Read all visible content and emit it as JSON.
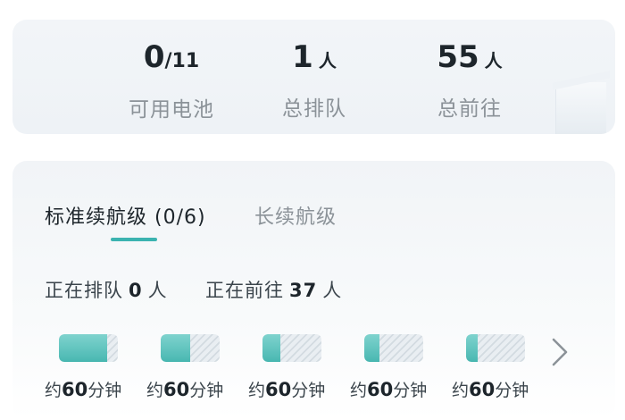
{
  "summary": {
    "stats": [
      {
        "value": "0",
        "fraction": "/11",
        "suffix": "",
        "label": "可用电池"
      },
      {
        "value": "1",
        "fraction": "",
        "suffix": "人",
        "label": "总排队"
      },
      {
        "value": "55",
        "fraction": "",
        "suffix": "人",
        "label": "总前往"
      }
    ]
  },
  "tabs": [
    {
      "label": "标准续航级 (0/6)",
      "active": true
    },
    {
      "label": "长续航级",
      "active": false
    }
  ],
  "queue": {
    "queuing_label": "正在排队",
    "queuing_count": "0",
    "queuing_unit": "人",
    "heading_label": "正在前往",
    "heading_count": "37",
    "heading_unit": "人"
  },
  "batteries": [
    {
      "fill_fraction": 0.82,
      "eta_prefix": "约",
      "eta_value": "60",
      "eta_unit": "分钟"
    },
    {
      "fill_fraction": 0.5,
      "eta_prefix": "约",
      "eta_value": "60",
      "eta_unit": "分钟"
    },
    {
      "fill_fraction": 0.3,
      "eta_prefix": "约",
      "eta_value": "60",
      "eta_unit": "分钟"
    },
    {
      "fill_fraction": 0.25,
      "eta_prefix": "约",
      "eta_value": "60",
      "eta_unit": "分钟"
    },
    {
      "fill_fraction": 0.2,
      "eta_prefix": "约",
      "eta_value": "60",
      "eta_unit": "分钟"
    }
  ],
  "icons": {
    "next": "chevron-right-icon"
  },
  "colors": {
    "accent": "#3bb3b0",
    "battery_fill": "#48b7b1",
    "muted_text": "#8b9298"
  }
}
